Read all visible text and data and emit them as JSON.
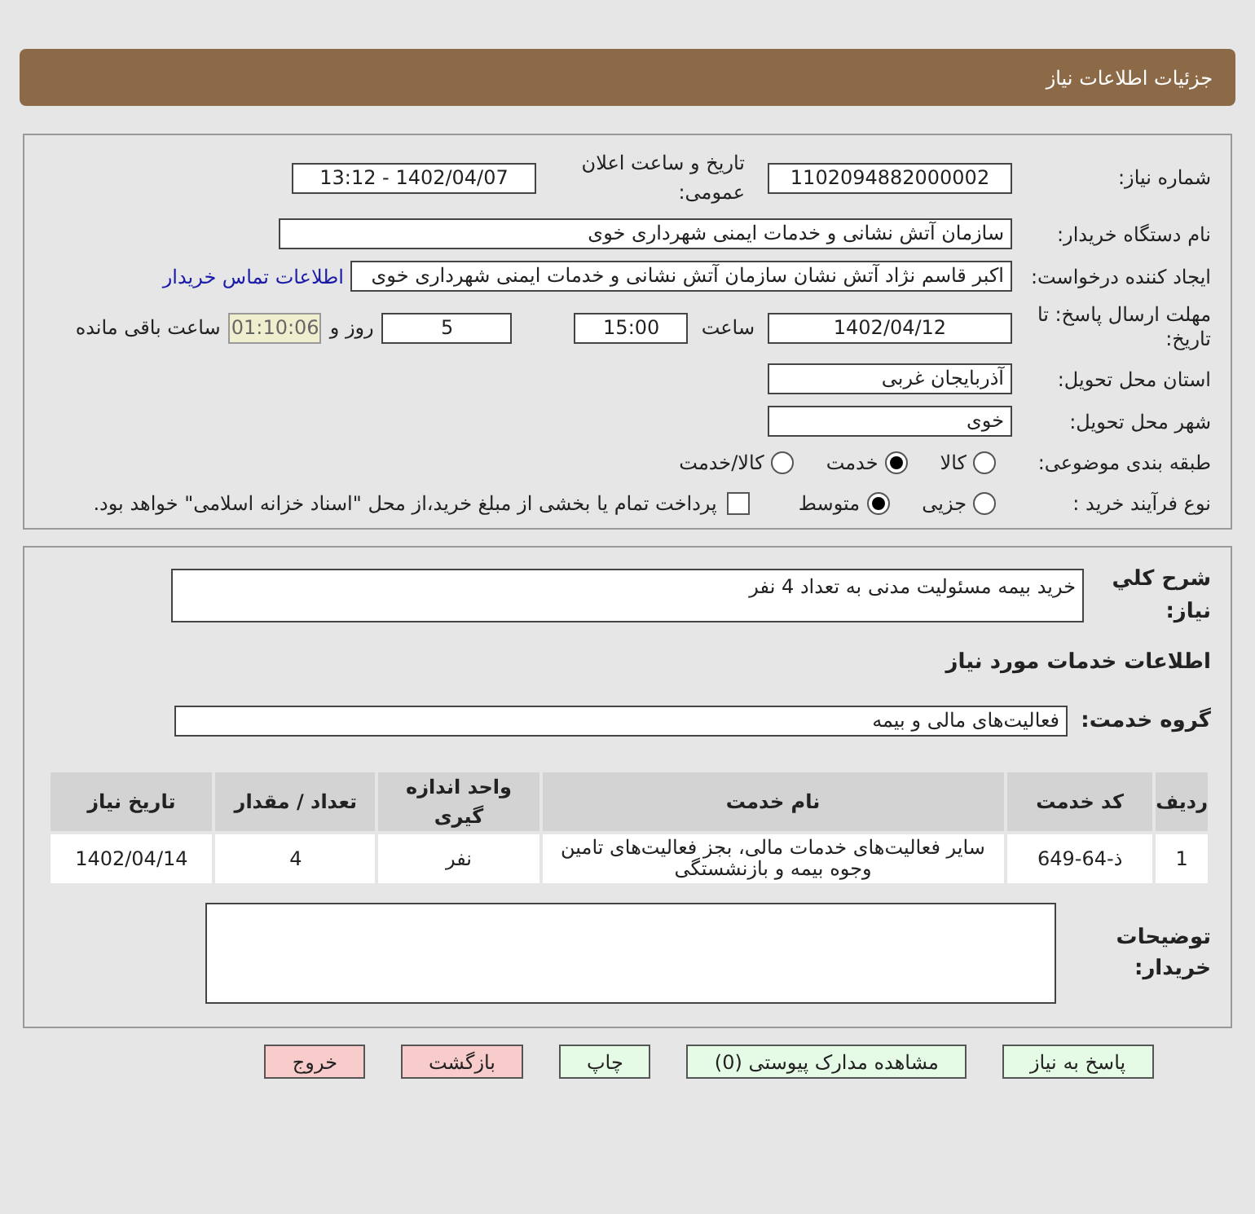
{
  "header": {
    "title": "جزئیات اطلاعات نیاز"
  },
  "need_number": {
    "label": "شماره نیاز:",
    "value": "1102094882000002"
  },
  "announce": {
    "label": "تاریخ و ساعت اعلان عمومی:",
    "value": "1402/04/07 - 13:12"
  },
  "buyer_org": {
    "label": "نام دستگاه خریدار:",
    "value": "سازمان آتش نشانی و خدمات ایمنی شهرداری خوی"
  },
  "requester": {
    "label": "ایجاد کننده درخواست:",
    "value": "اکبر قاسم نژاد آتش نشان سازمان آتش نشانی و خدمات ایمنی شهرداری خوی",
    "link": "اطلاعات تماس خریدار"
  },
  "deadline": {
    "label": "مهلت ارسال پاسخ: تا تاریخ:",
    "date": "1402/04/12",
    "time_label": "ساعت",
    "time": "15:00",
    "days": "5",
    "days_label": "روز و",
    "remaining": "01:10:06",
    "remaining_label": "ساعت باقی مانده"
  },
  "province": {
    "label": "استان محل تحویل:",
    "value": "آذربایجان غربی"
  },
  "city": {
    "label": "شهر محل تحویل:",
    "value": "خوی"
  },
  "category": {
    "label": "طبقه بندی موضوعی:",
    "options": [
      {
        "label": "کالا",
        "selected": false
      },
      {
        "label": "خدمت",
        "selected": true
      },
      {
        "label": "کالا/خدمت",
        "selected": false
      }
    ]
  },
  "process": {
    "label": "نوع فرآیند خرید :",
    "options": [
      {
        "label": "جزیی",
        "selected": false
      },
      {
        "label": "متوسط",
        "selected": true
      }
    ],
    "treasury": {
      "checked": false,
      "text": "پرداخت تمام یا بخشی از مبلغ خرید،از محل \"اسناد خزانه اسلامی\" خواهد بود."
    }
  },
  "summary": {
    "label": "شرح کلي نیاز:",
    "value": "خرید بیمه مسئولیت مدنی به تعداد 4 نفر"
  },
  "services_heading": "اطلاعات خدمات مورد نیاز",
  "service_group": {
    "label": "گروه خدمت:",
    "value": "فعالیت‌های مالی و بیمه"
  },
  "table": {
    "columns": [
      "ردیف",
      "کد خدمت",
      "نام خدمت",
      "واحد اندازه گیری",
      "تعداد / مقدار",
      "تاریخ نیاز"
    ],
    "rows": [
      [
        "1",
        "ذ-64-649",
        "سایر فعالیت‌های خدمات مالی، بجز فعالیت‌های تامین وجوه بیمه و بازنشستگی",
        "نفر",
        "4",
        "1402/04/14"
      ]
    ]
  },
  "buyer_notes": {
    "label": "توضیحات خریدار:"
  },
  "buttons": [
    {
      "label": "پاسخ به نیاز",
      "kind": "normal"
    },
    {
      "label": "مشاهده مدارک پیوستی (0)",
      "kind": "normal"
    },
    {
      "label": "چاپ",
      "kind": "normal"
    },
    {
      "label": "بازگشت",
      "kind": "danger"
    },
    {
      "label": "خروج",
      "kind": "danger"
    }
  ]
}
